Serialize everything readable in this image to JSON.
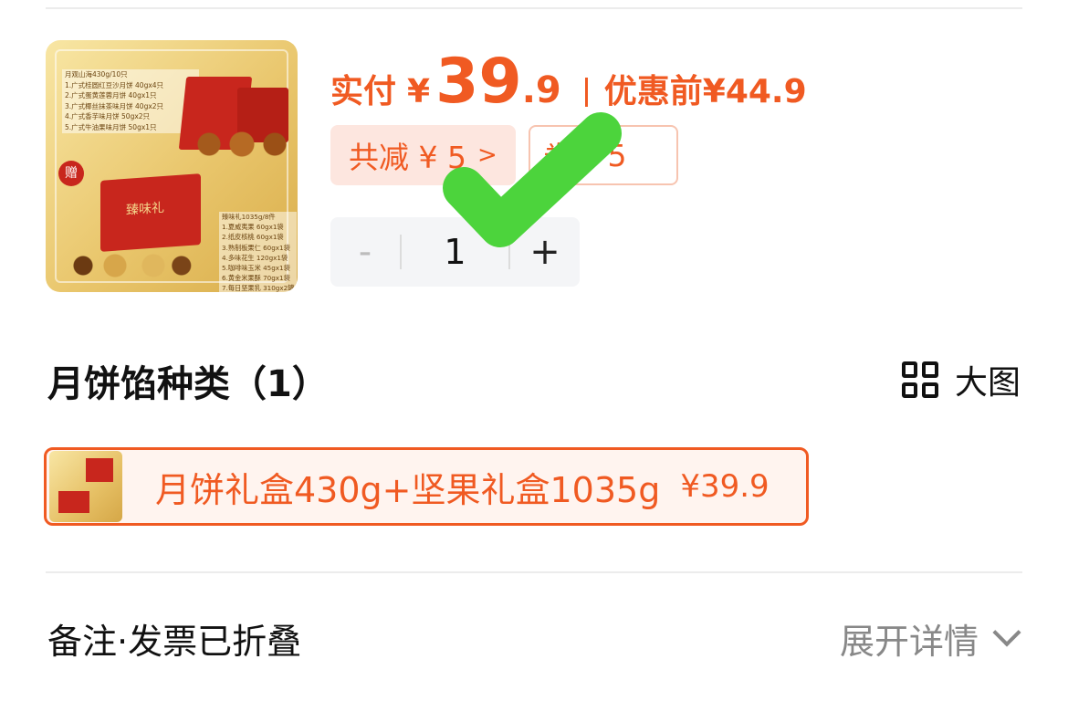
{
  "product": {
    "thumb_title": "月观山海430g/10只",
    "thumb_lines": [
      "1.广式桂圆红豆沙月饼 40gx4只",
      "2.广式蛋黄莲蓉月饼 40gx1只",
      "3.广式椰丝抹茶味月饼 40gx2只",
      "4.广式香芋味月饼 50gx2只",
      "5.广式牛油果味月饼 50gx1只"
    ],
    "thumb_title2": "臻味礼1035g/8件",
    "thumb_lines2": [
      "1.夏威夷果 60gx1袋",
      "2.纸皮核桃 60gx1袋",
      "3.熟制板栗仁 60gx1袋",
      "4.多味花生 120gx1袋",
      "5.咖啡味玉米 45gx1袋",
      "6.黄金米果酥 70gx1袋",
      "7.每日坚果乳 310gx2罐"
    ],
    "thumb_gift": "赠",
    "thumb_box_text": "臻味礼"
  },
  "price": {
    "paid_label": "实付",
    "yen": "¥",
    "paid_int": "39",
    "paid_dec": ".9",
    "orig_label": "优惠前",
    "orig_price": "¥44.9"
  },
  "discounts": {
    "total_label": "共减 ¥ 5",
    "total_arrow": ">",
    "coupon_label": "券",
    "coupon_value": "¥ 5"
  },
  "stepper": {
    "minus": "-",
    "value": "1",
    "plus": "+"
  },
  "section": {
    "title": "月饼馅种类（1）",
    "big_view_label": "大图"
  },
  "option": {
    "label": "月饼礼盒430g+坚果礼盒1035g",
    "price": "¥39.9",
    "selected": true
  },
  "remark": {
    "label": "备注·发票已折叠",
    "expand_label": "展开详情"
  },
  "colors": {
    "accent": "#f05a22",
    "check": "#4cd43c"
  }
}
